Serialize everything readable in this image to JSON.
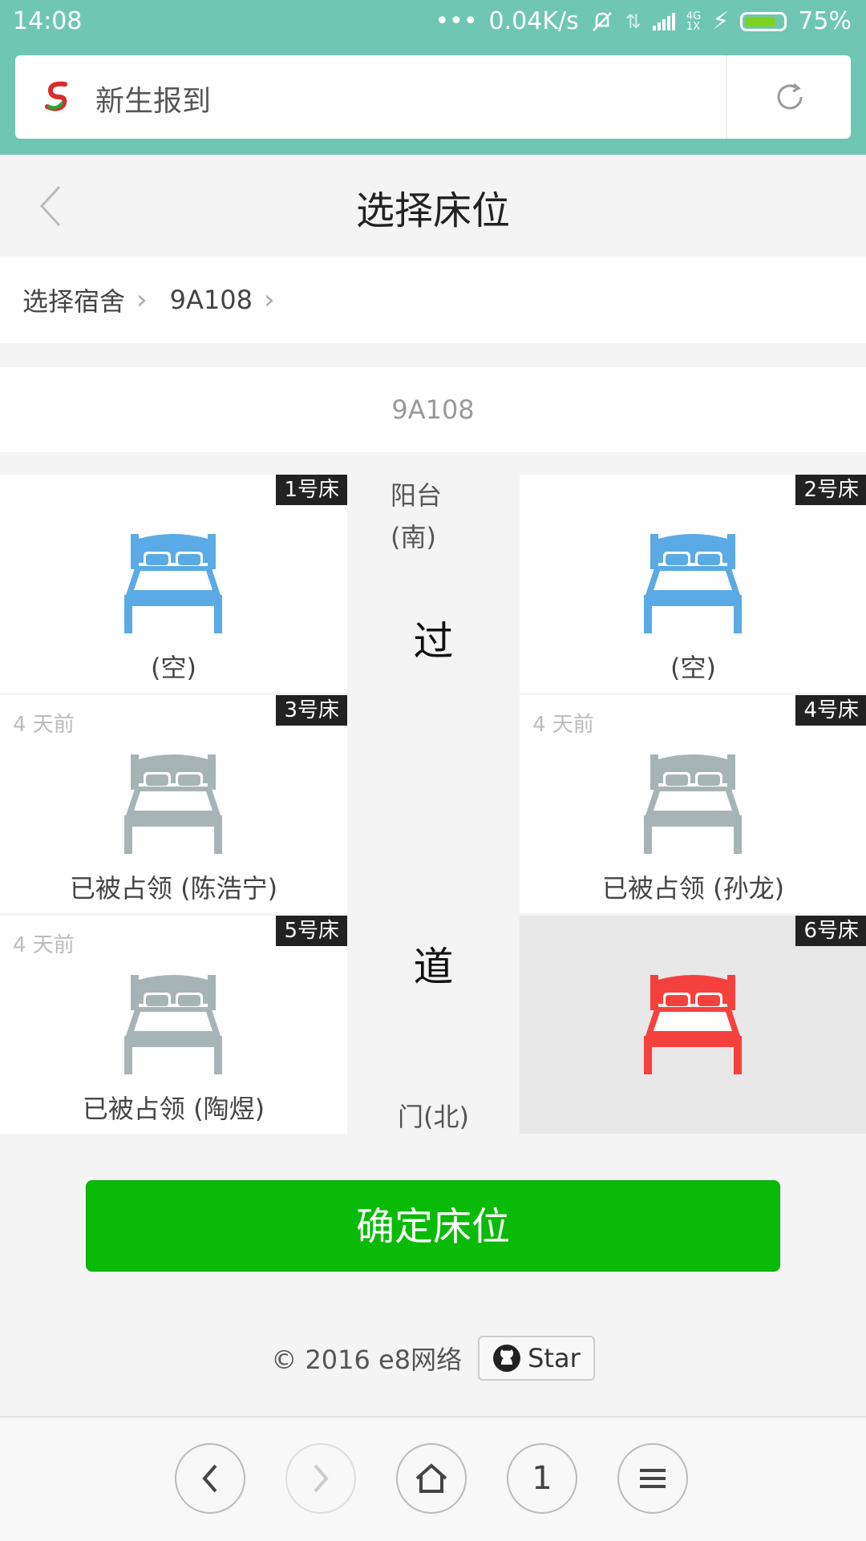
{
  "status_bar": {
    "time": "14:08",
    "speed": "0.04K/s",
    "network_badge_top": "4G",
    "network_badge_bottom": "1X",
    "battery": "75%"
  },
  "browser": {
    "url_text": "新生报到",
    "icons": {
      "logo": "site-logo-icon",
      "reload": "reload-icon"
    }
  },
  "page": {
    "title": "选择床位",
    "breadcrumbs": [
      "选择宿舍",
      "9A108"
    ],
    "room": "9A108"
  },
  "layout_labels": {
    "balcony_line1": "阳台",
    "balcony_line2": "(南)",
    "aisle_char1": "过",
    "aisle_char2": "道",
    "door": "门(北)"
  },
  "beds": [
    {
      "number": "1号床",
      "ago": "",
      "status": "(空)",
      "state": "empty"
    },
    {
      "number": "2号床",
      "ago": "",
      "status": "(空)",
      "state": "empty"
    },
    {
      "number": "3号床",
      "ago": "4 天前",
      "status": "已被占领 (陈浩宁)",
      "state": "occupied"
    },
    {
      "number": "4号床",
      "ago": "4 天前",
      "status": "已被占领 (孙龙)",
      "state": "occupied"
    },
    {
      "number": "5号床",
      "ago": "4 天前",
      "status": "已被占领 (陶煜)",
      "state": "occupied"
    },
    {
      "number": "6号床",
      "ago": "",
      "status": "",
      "state": "selected"
    }
  ],
  "colors": {
    "empty": "#5aaae5",
    "occupied": "#a7b4b5",
    "selected": "#f5413e",
    "confirm": "#09bb07",
    "header": "#6fc7b3"
  },
  "confirm_label": "确定床位",
  "footer": {
    "copyright": "© 2016 e8网络",
    "star_label": "Star"
  },
  "nav": {
    "tabs_count": "1"
  }
}
